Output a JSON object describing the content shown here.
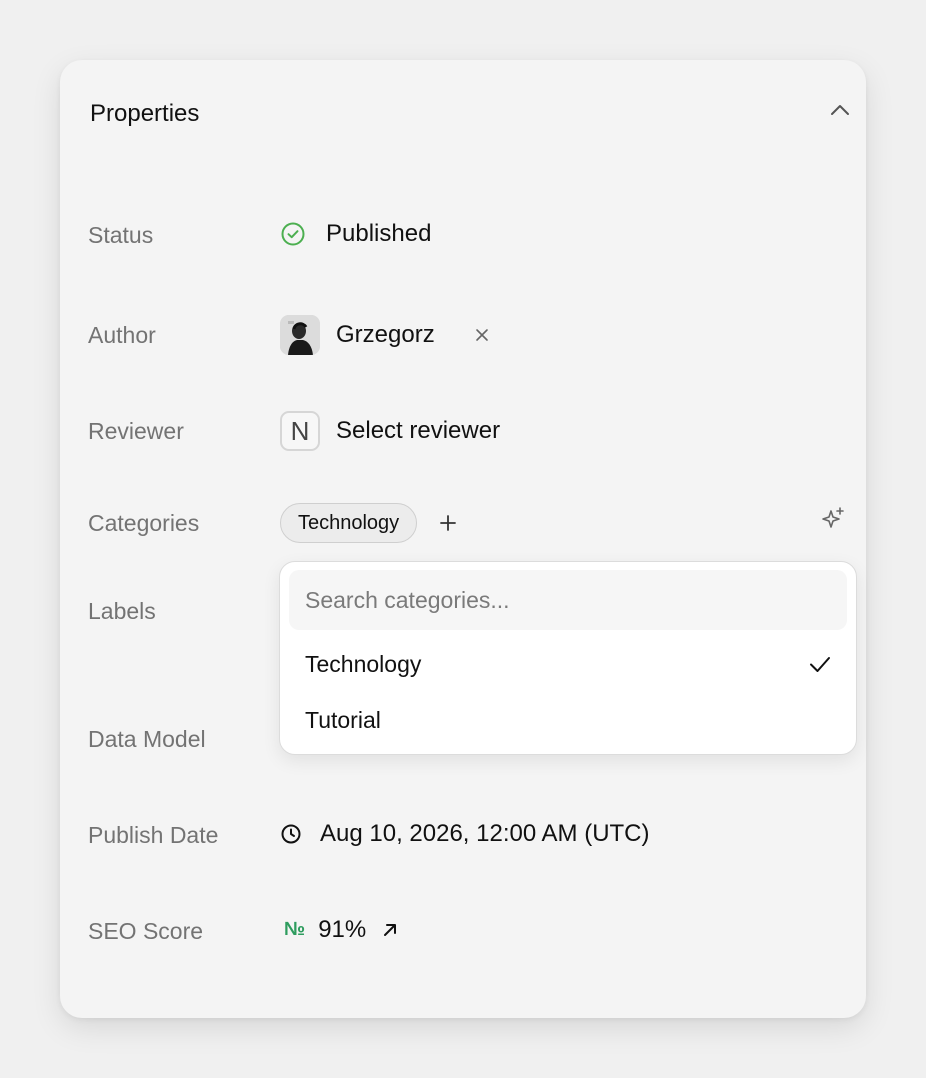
{
  "panel": {
    "title": "Properties"
  },
  "rows": {
    "status": {
      "label": "Status",
      "value": "Published"
    },
    "author": {
      "label": "Author",
      "value": "Grzegorz"
    },
    "reviewer": {
      "label": "Reviewer",
      "badge": "N",
      "value": "Select reviewer"
    },
    "categories": {
      "label": "Categories",
      "chips": [
        "Technology"
      ]
    },
    "labels": {
      "label": "Labels"
    },
    "data_model": {
      "label": "Data Model"
    },
    "publish_date": {
      "label": "Publish Date",
      "value": "Aug 10, 2026, 12:00 AM (UTC)"
    },
    "seo_score": {
      "label": "SEO Score",
      "prefix": "№",
      "value": "91%"
    }
  },
  "category_dropdown": {
    "search_placeholder": "Search categories...",
    "search_value": "",
    "options": [
      {
        "label": "Technology",
        "selected": true
      },
      {
        "label": "Tutorial",
        "selected": false
      }
    ]
  },
  "icons": {
    "collapse": "chevron-up-icon",
    "status": "check-circle-icon",
    "remove": "close-icon",
    "add": "plus-icon",
    "ai": "sparkle-icon",
    "check": "checkmark-icon",
    "date": "clock-icon",
    "external": "arrow-up-right-icon"
  },
  "colors": {
    "status_green": "#4caf50",
    "seo_green": "#2e9c5e",
    "label_gray": "#737373"
  }
}
